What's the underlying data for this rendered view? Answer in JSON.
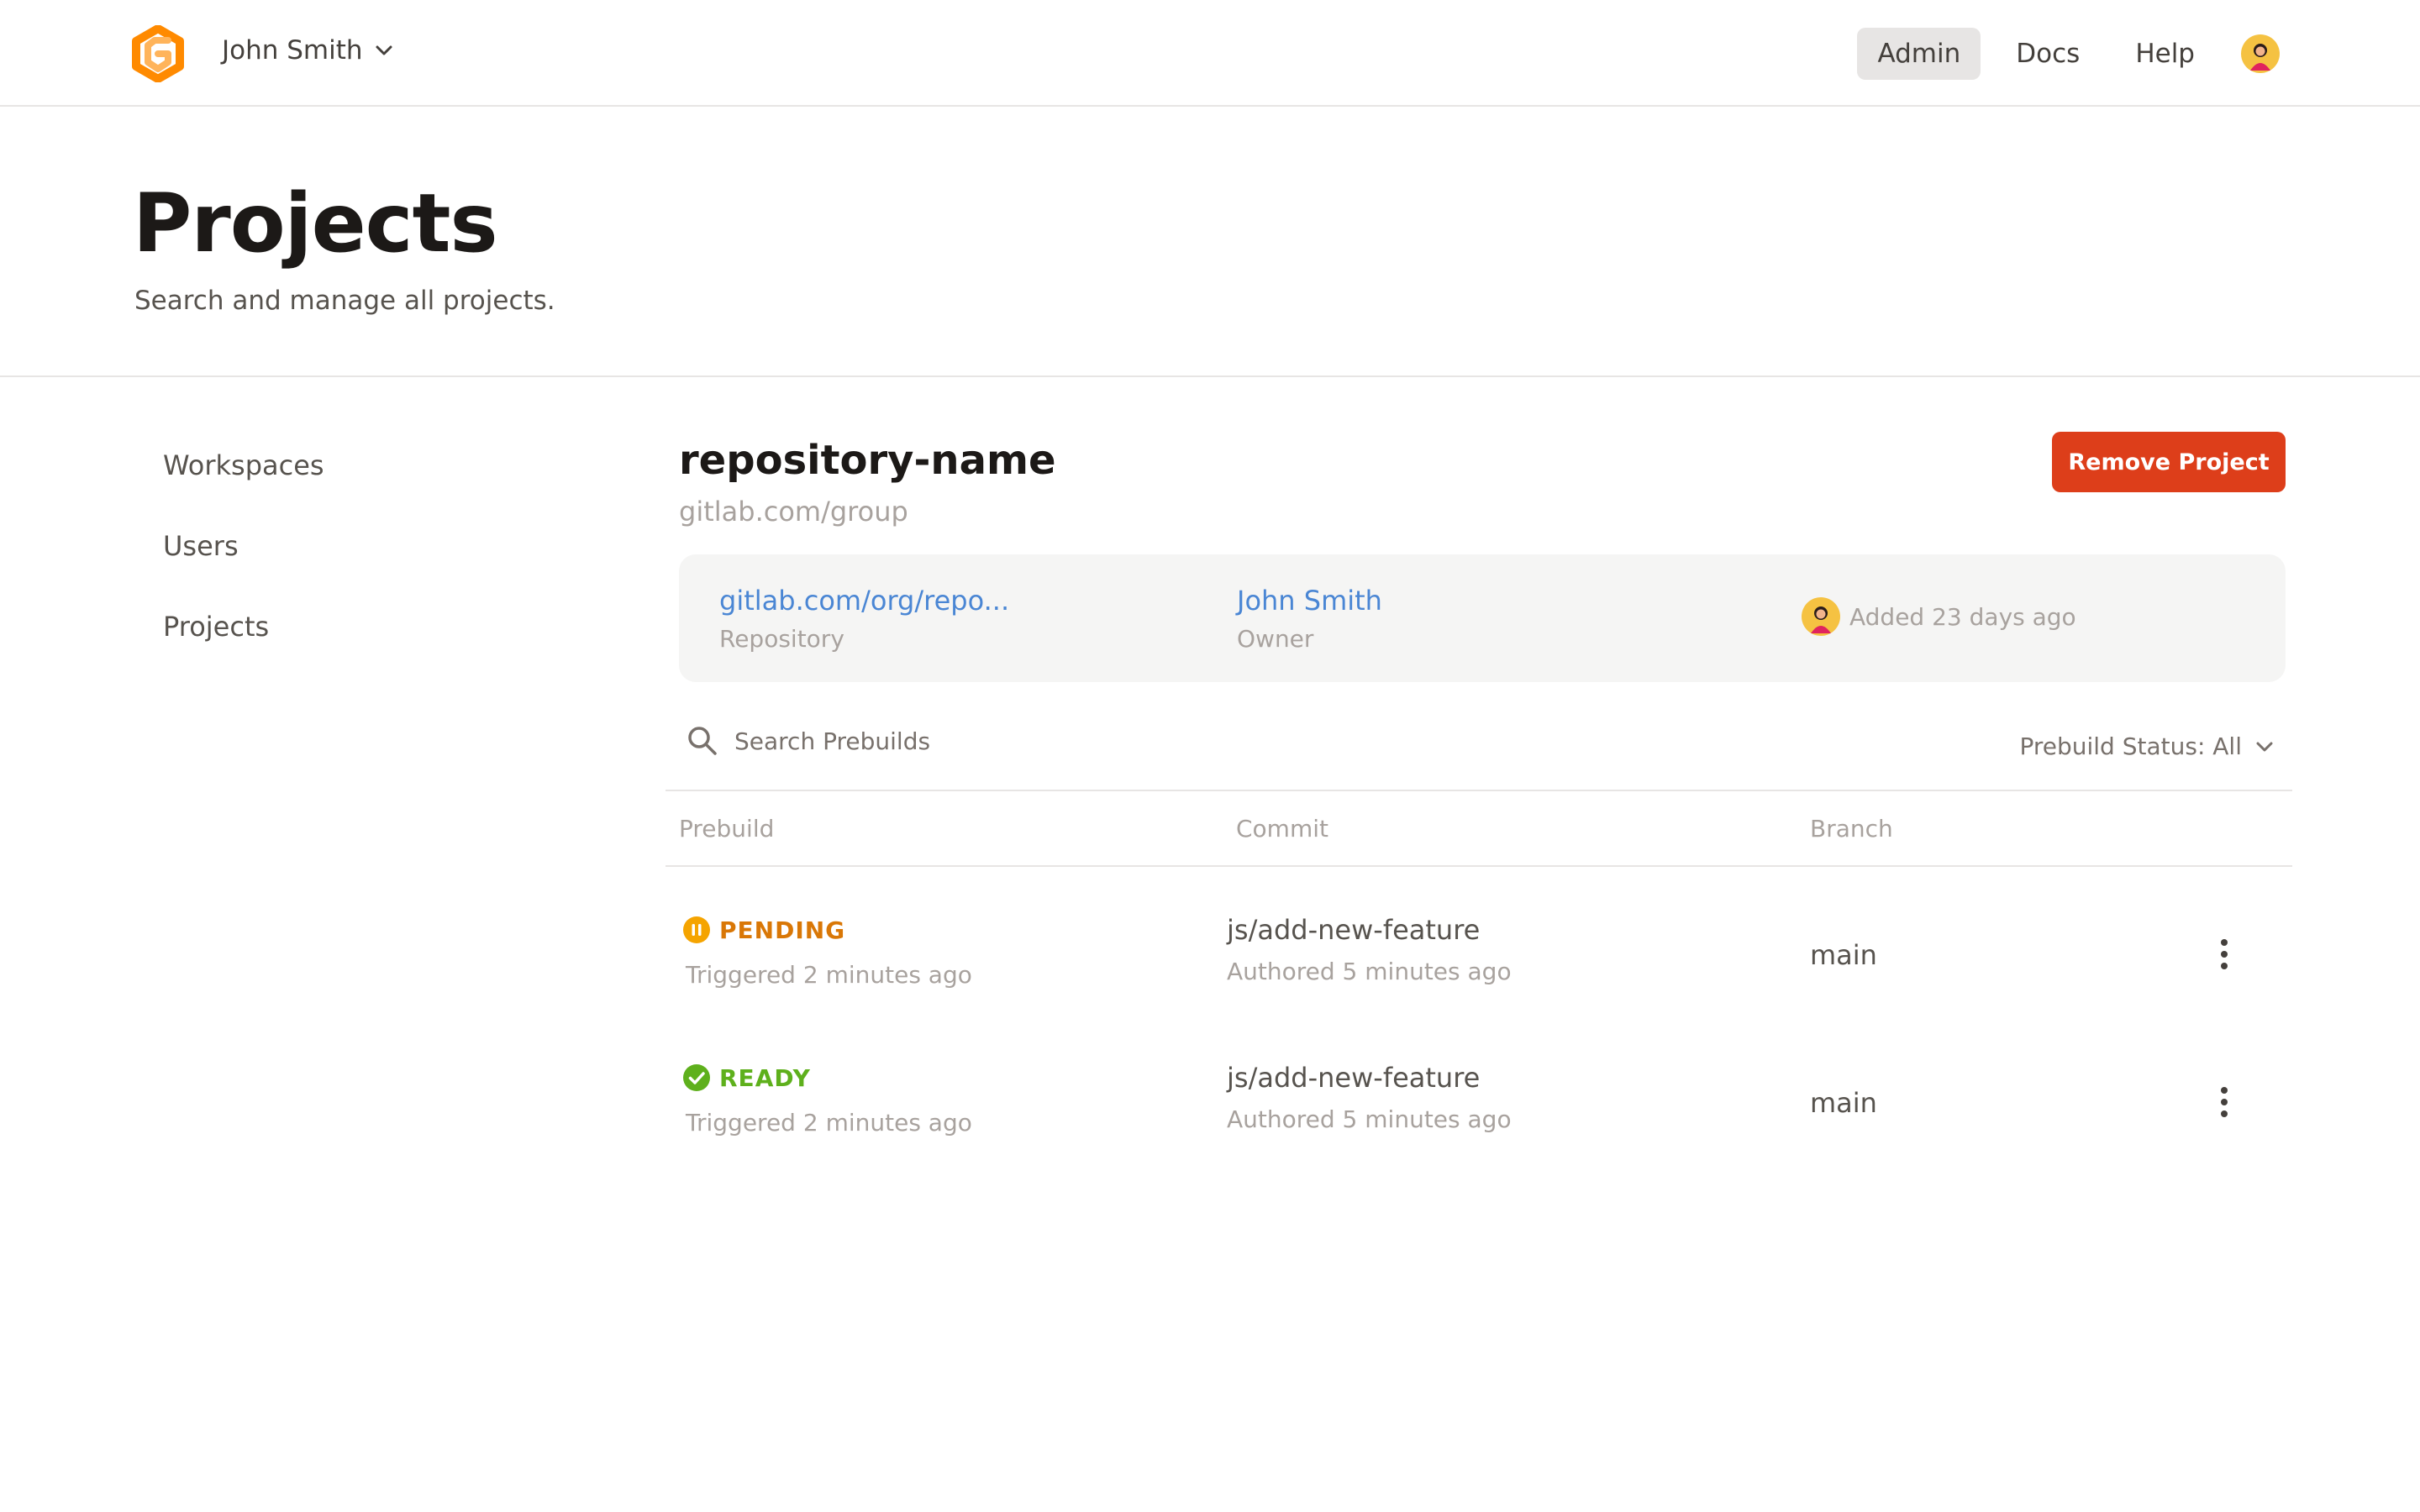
{
  "header": {
    "account_name": "John Smith",
    "nav": [
      "Admin",
      "Docs",
      "Help"
    ],
    "active_nav": "Admin"
  },
  "page": {
    "title": "Projects",
    "subtitle": "Search and manage all projects."
  },
  "sidebar": {
    "items": [
      {
        "label": "Workspaces"
      },
      {
        "label": "Users"
      },
      {
        "label": "Projects"
      }
    ]
  },
  "project": {
    "name": "repository-name",
    "group": "gitlab.com/group",
    "remove_label": "Remove Project",
    "repository": {
      "value": "gitlab.com/org/repo...",
      "label": "Repository"
    },
    "owner": {
      "value": "John Smith",
      "label": "Owner"
    },
    "added": "Added 23 days ago"
  },
  "search": {
    "placeholder": "Search Prebuilds"
  },
  "filter": {
    "label": "Prebuild Status: All"
  },
  "table": {
    "columns": [
      "Prebuild",
      "Commit",
      "Branch"
    ],
    "rows": [
      {
        "status": "PENDING",
        "triggered": "Triggered 2 minutes ago",
        "commit": "js/add-new-feature",
        "authored": "Authored 5 minutes ago",
        "branch": "main"
      },
      {
        "status": "READY",
        "triggered": "Triggered 2 minutes ago",
        "commit": "js/add-new-feature",
        "authored": "Authored 5 minutes ago",
        "branch": "main"
      }
    ]
  },
  "colors": {
    "brand": "#ff8a00",
    "danger": "#dd3e1a",
    "link": "#4a86d4",
    "pending": "#f5a400",
    "ready": "#5eb01c"
  },
  "icons": [
    "gitpod-logo-icon",
    "chevron-down-icon",
    "user-avatar-icon",
    "search-icon",
    "pending-status-icon",
    "ready-status-icon",
    "more-vertical-icon"
  ]
}
